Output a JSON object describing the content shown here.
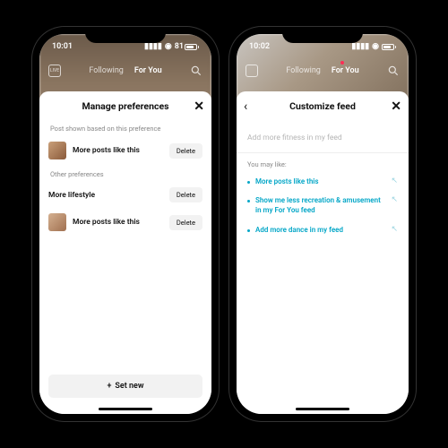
{
  "phone1": {
    "status": {
      "time": "10:01",
      "battery": "81"
    },
    "tabs": {
      "following": "Following",
      "foryou": "For You",
      "live_badge": "LIVE"
    },
    "sheet": {
      "title": "Manage preferences",
      "section_current": "Post shown based on this preference",
      "section_other": "Other preferences",
      "rows": [
        {
          "label": "More posts like this",
          "delete": "Delete"
        },
        {
          "label": "More lifestyle",
          "delete": "Delete"
        },
        {
          "label": "More posts like this",
          "delete": "Delete"
        }
      ],
      "set_new": "Set new"
    }
  },
  "phone2": {
    "status": {
      "time": "10:02"
    },
    "tabs": {
      "following": "Following",
      "foryou": "For You"
    },
    "sheet": {
      "title": "Customize feed",
      "placeholder": "Add more fitness in my feed",
      "you_may_like": "You may like:",
      "suggestions": [
        "More posts like this",
        "Show me less recreation & amusement in my For You feed",
        "Add more dance in my feed"
      ]
    }
  }
}
